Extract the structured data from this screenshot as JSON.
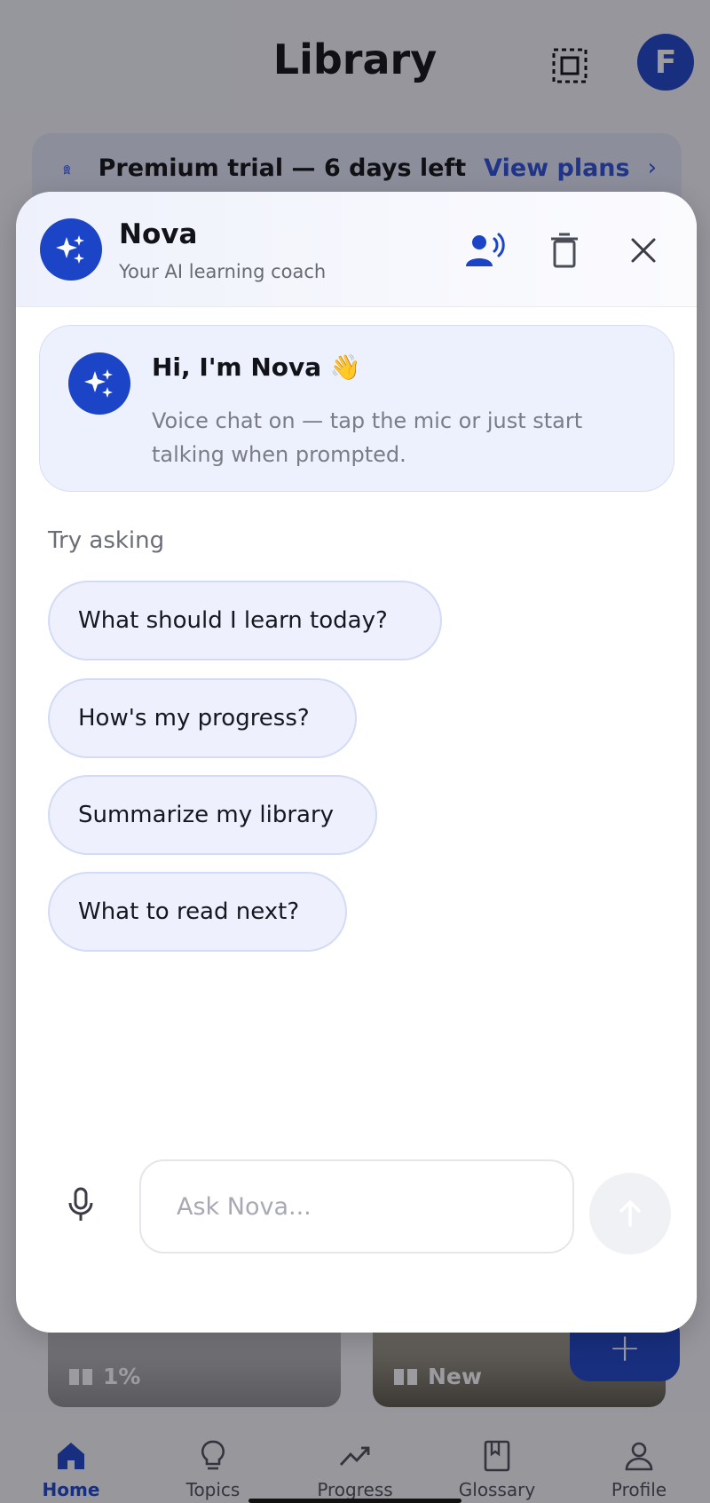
{
  "app": {
    "title": "Library",
    "avatar_initial": "F"
  },
  "trial_banner": {
    "text": "Premium trial — 6 days left",
    "link": "View plans",
    "chevron": "›"
  },
  "cards": [
    {
      "badge": "1%",
      "icon": "book-icon"
    },
    {
      "badge": "New",
      "icon": "book-icon"
    }
  ],
  "fab": {
    "label": "+"
  },
  "bottom_nav": [
    {
      "label": "Home",
      "icon": "home-icon",
      "active": true
    },
    {
      "label": "Topics",
      "icon": "lightbulb-icon",
      "active": false
    },
    {
      "label": "Progress",
      "icon": "trending-icon",
      "active": false
    },
    {
      "label": "Glossary",
      "icon": "glossary-icon",
      "active": false
    },
    {
      "label": "Profile",
      "icon": "person-icon",
      "active": false
    }
  ],
  "assistant": {
    "name": "Nova",
    "subtitle": "Your AI learning coach",
    "greeting_title": "Hi, I'm Nova 👋",
    "greeting_body": "Voice chat on — tap the mic or just start talking when prompted.",
    "try_label": "Try asking",
    "suggestions": [
      "What should I learn today?",
      "How's my progress?",
      "Summarize my library",
      "What to read next?"
    ],
    "input_placeholder": "Ask Nova...",
    "icons": {
      "voice": "voice-chat-icon",
      "clear": "trash-icon",
      "close": "close-icon",
      "mic": "mic-icon",
      "send": "send-arrow-icon"
    }
  },
  "colors": {
    "accent": "#1c44c7",
    "link": "#2c4fd6",
    "chip_bg": "#eef1fd",
    "chip_border": "#d3dbf6"
  }
}
